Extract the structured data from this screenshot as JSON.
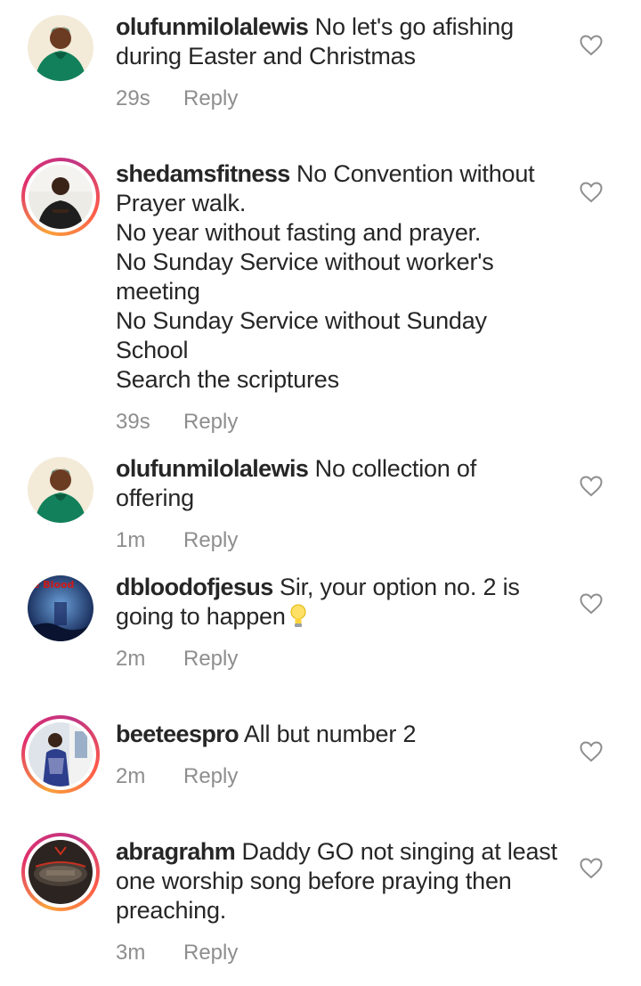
{
  "comments": [
    {
      "username": "olufunmilolalewis",
      "text": "No let's go afishing\nduring Easter and Christmas",
      "time": "29s",
      "reply": "Reply",
      "avatar_ring": false
    },
    {
      "username": "shedamsfitness",
      "text": "No Convention without\nPrayer walk.\nNo year without fasting and prayer.\nNo Sunday Service without worker's\nmeeting\nNo Sunday Service without Sunday School\nSearch the scriptures",
      "time": "39s",
      "reply": "Reply",
      "avatar_ring": true
    },
    {
      "username": "olufunmilolalewis",
      "text": "No collection of offering",
      "time": "1m",
      "reply": "Reply",
      "avatar_ring": false
    },
    {
      "username": "dbloodofjesus",
      "text": "Sir, your option no. 2 is\ngoing to happen",
      "time": "2m",
      "reply": "Reply",
      "avatar_ring": false,
      "avatar_text": "e Blood"
    },
    {
      "username": "beeteespro",
      "text": "All but number 2",
      "time": "2m",
      "reply": "Reply",
      "avatar_ring": true
    },
    {
      "username": "abragrahm",
      "text": "Daddy GO not singing at least\none worship song before praying then\npreaching.",
      "time": "3m",
      "reply": "Reply",
      "avatar_ring": true
    }
  ],
  "icons": {
    "like": "heart-outline-icon",
    "emoji": "light-bulb-emoji"
  },
  "colors": {
    "text": "#262626",
    "meta": "#8e8e8e",
    "heart": "#8e8e8e"
  }
}
